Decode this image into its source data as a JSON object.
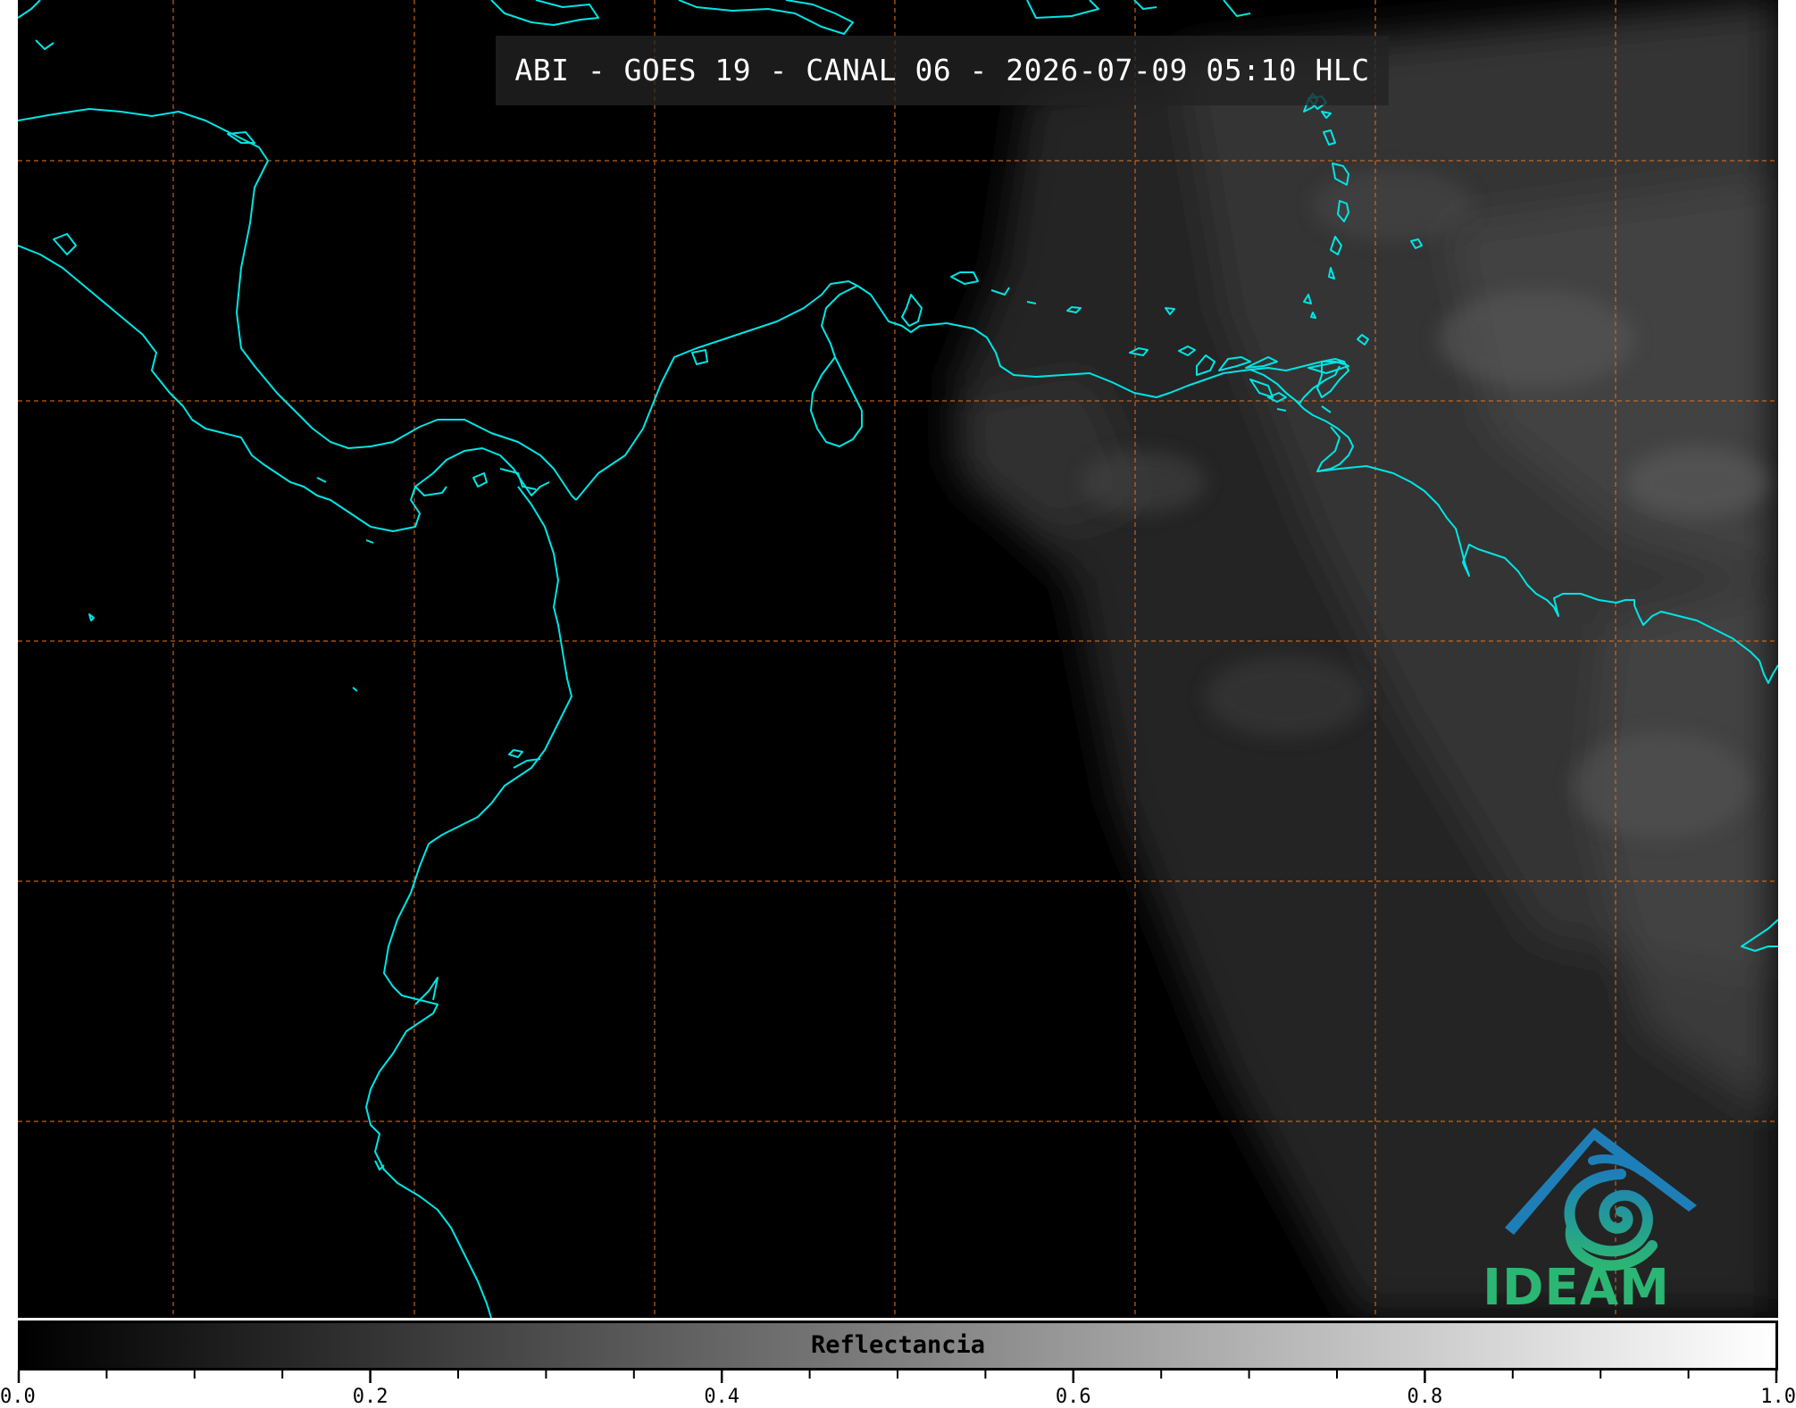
{
  "title": "ABI - GOES 19 - CANAL 06 - 2026-07-09 05:10 HLC",
  "colors": {
    "background": "#000000",
    "coastline": "#00e5e5",
    "graticule": "#e07020",
    "logo_primary": "#1e7fb8",
    "logo_secondary": "#2bb673"
  },
  "logo": {
    "text": "IDEAM",
    "icon": "ideam-mountain-swirl-icon"
  },
  "colorbar": {
    "label": "Reflectancia",
    "min": 0.0,
    "max": 1.0,
    "tick_labels": [
      "0.0",
      "0.2",
      "0.4",
      "0.6",
      "0.8",
      "1.0"
    ],
    "tick_values": [
      0.0,
      0.2,
      0.4,
      0.6,
      0.8,
      1.0
    ],
    "minor_step": 0.05,
    "gradient": [
      "#000000",
      "#ffffff"
    ]
  }
}
